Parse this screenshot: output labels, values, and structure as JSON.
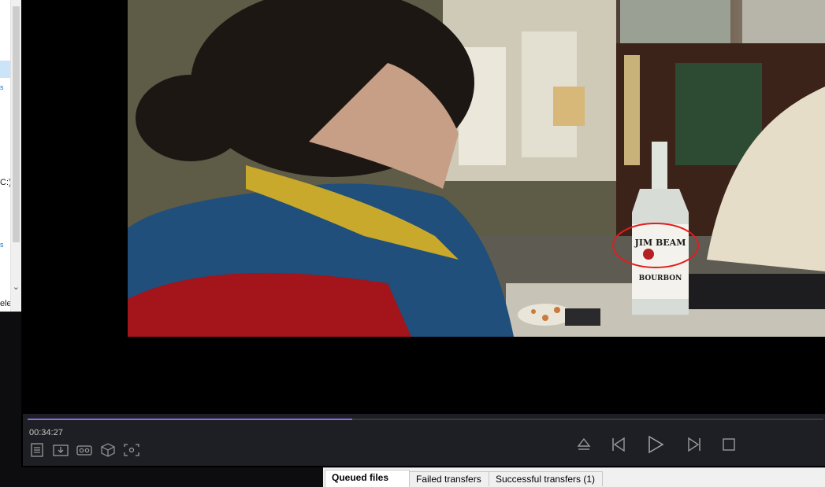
{
  "explorer": {
    "drive_fragment": "C:)",
    "select_fragment": "elect"
  },
  "player": {
    "time": "00:34:27",
    "progress_fraction": 0.408,
    "accent_color": "#8f68e8",
    "tools": [
      "playlist-icon",
      "download-icon",
      "vr-icon",
      "3d-cube-icon",
      "screenshot-icon"
    ],
    "controls": [
      "eject-icon",
      "previous-icon",
      "play-icon",
      "next-icon",
      "stop-icon"
    ]
  },
  "video": {
    "label_line1": "JIM BEAM",
    "label_line2": "BOURBON"
  },
  "transfers": {
    "tabs": [
      {
        "label": "Queued files"
      },
      {
        "label": "Failed transfers"
      },
      {
        "label": "Successful transfers (1)"
      }
    ]
  }
}
